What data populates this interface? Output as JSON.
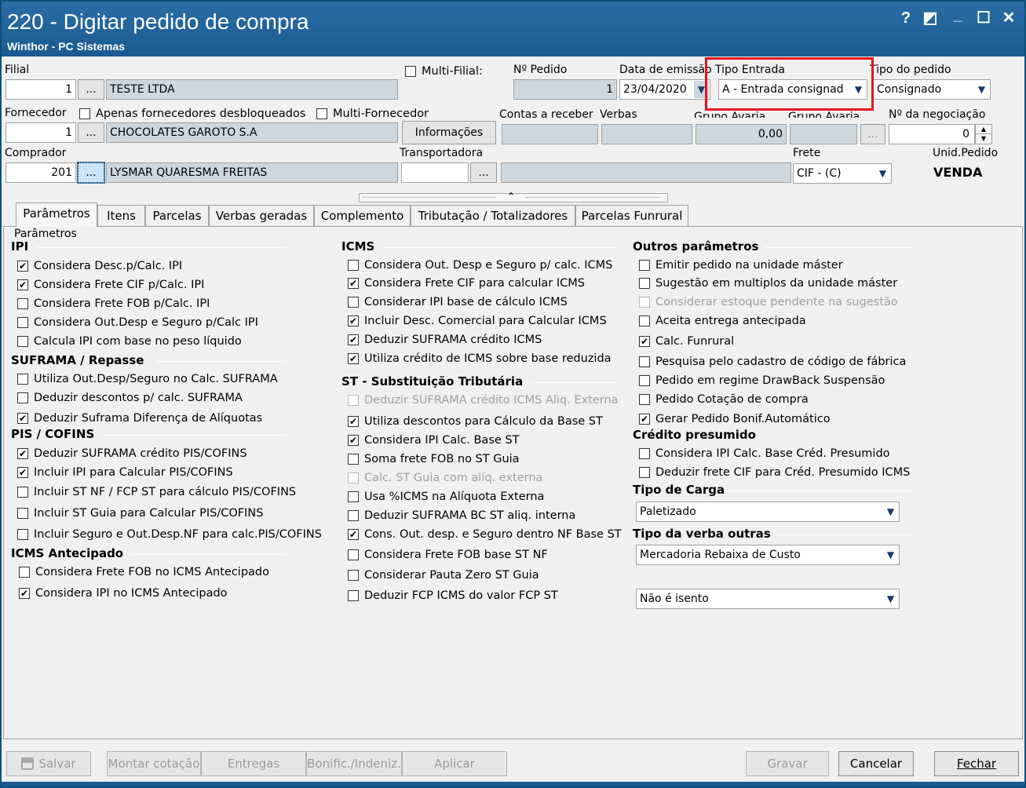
{
  "window": {
    "title": "220 - Digitar pedido de compra",
    "subtitle": "Winthor - PC Sistemas",
    "controls": [
      "?",
      "◩",
      "_",
      "☐",
      "✕"
    ]
  },
  "header": {
    "filial_label": "Filial",
    "filial_code": "1",
    "filial_name": "TESTE  LTDA",
    "multi_filial_label": "Multi-Filial:",
    "num_pedido_label": "Nº Pedido",
    "num_pedido": "1",
    "data_emissao_label": "Data de emissão",
    "data_emissao": "23/04/2020",
    "tipo_entrada_label": "Tipo Entrada",
    "tipo_entrada": "A - Entrada consignad",
    "tipo_pedido_label": "Tipo do pedido",
    "tipo_pedido": "Consignado",
    "fornecedor_label": "Fornecedor",
    "apenas_desbloqueados_label": "Apenas fornecedores desbloqueados",
    "multi_fornecedor_label": "Multi-Fornecedor",
    "fornecedor_code": "1",
    "fornecedor_name": "CHOCOLATES GAROTO S.A",
    "informacoes_label": "Informações",
    "contas_receber_label": "Contas a receber",
    "verbas_label": "Verbas",
    "grupo_avaria_label1": "Grupo Avaria",
    "grupo_avaria_value": "0,00",
    "grupo_avaria_label2": "Grupo Avaria",
    "num_negociacao_label": "Nº da negociação",
    "num_negociacao": "0",
    "comprador_label": "Comprador",
    "comprador_code": "201",
    "comprador_name": "LYSMAR QUARESMA FREITAS",
    "transportadora_label": "Transportadora",
    "frete_label": "Frete",
    "frete": "CIF - (C)",
    "unid_pedido_label": "Unid.Pedido",
    "unid_pedido": "VENDA",
    "ellipsis": "..."
  },
  "highlight_color": "#e8141c",
  "tabs": [
    "Parâmetros",
    "Itens",
    "Parcelas",
    "Verbas geradas",
    "Complemento",
    "Tributação / Totalizadores",
    "Parcelas Funrural"
  ],
  "group_title": "Parâmetros",
  "col1": {
    "ipi_title": "IPI",
    "ipi": [
      {
        "label": "Considera Desc.p/Calc. IPI",
        "checked": true
      },
      {
        "label": "Considera Frete CIF p/Calc. IPI",
        "checked": true
      },
      {
        "label": "Considera Frete FOB p/Calc. IPI",
        "checked": false
      },
      {
        "label": "Considera Out.Desp e Seguro p/Calc IPI",
        "checked": false
      },
      {
        "label": "Calcula IPI com base no peso líquido",
        "checked": false
      }
    ],
    "suframa_title": "SUFRAMA / Repasse",
    "suframa": [
      {
        "label": "Utiliza Out.Desp/Seguro no Calc. SUFRAMA",
        "checked": false
      },
      {
        "label": "Deduzir descontos p/ calc. SUFRAMA",
        "checked": false
      },
      {
        "label": "Deduzir Suframa Diferença de Alíquotas",
        "checked": true
      }
    ],
    "pis_title": "PIS / COFINS",
    "pis": [
      {
        "label": "Deduzir SUFRAMA crédito PIS/COFINS",
        "checked": true
      },
      {
        "label": "Incluir IPI para Calcular PIS/COFINS",
        "checked": true
      },
      {
        "label": "Incluir ST NF / FCP ST para cálculo PIS/COFINS",
        "checked": false
      },
      {
        "label": "Incluir ST Guia para Calcular PIS/COFINS",
        "checked": false
      },
      {
        "label": "Incluir Seguro e Out.Desp.NF para calc.PIS/COFINS",
        "checked": false
      }
    ],
    "icmsant_title": "ICMS Antecipado",
    "icmsant": [
      {
        "label": "Considera Frete FOB no ICMS Antecipado",
        "checked": false
      },
      {
        "label": "Considera IPI no ICMS Antecipado",
        "checked": true
      }
    ]
  },
  "col2": {
    "icms_title": "ICMS",
    "icms": [
      {
        "label": "Considera Out. Desp e Seguro p/ calc. ICMS",
        "checked": false,
        "disabled": false
      },
      {
        "label": "Considera Frete CIF para calcular ICMS",
        "checked": true,
        "disabled": false
      },
      {
        "label": "Considerar IPI base de cálculo ICMS",
        "checked": false,
        "disabled": false
      },
      {
        "label": "Incluir Desc. Comercial  para Calcular ICMS",
        "checked": true,
        "disabled": false
      },
      {
        "label": "Deduzir SUFRAMA crédito ICMS",
        "checked": true,
        "disabled": false
      },
      {
        "label": "Utiliza crédito de ICMS sobre base reduzida",
        "checked": true,
        "disabled": false
      }
    ],
    "st_title": "ST - Substituição Tributária",
    "st": [
      {
        "label": "Deduzir SUFRAMA crédito ICMS Aliq. Externa",
        "checked": false,
        "disabled": true
      },
      {
        "label": "Utiliza descontos para Cálculo da Base ST",
        "checked": true,
        "disabled": false
      },
      {
        "label": "Considera IPI Calc. Base ST",
        "checked": true,
        "disabled": false
      },
      {
        "label": "Soma frete FOB no ST Guia",
        "checked": false,
        "disabled": false
      },
      {
        "label": "Calc. ST Guia com alíq. externa",
        "checked": false,
        "disabled": true
      },
      {
        "label": "Usa %ICMS na Alíquota Externa",
        "checked": false,
        "disabled": false
      },
      {
        "label": "Deduzir SUFRAMA BC ST aliq. interna",
        "checked": false,
        "disabled": false
      },
      {
        "label": "Cons. Out. desp. e Seguro dentro NF Base ST",
        "checked": true,
        "disabled": false
      },
      {
        "label": "Considera Frete FOB base ST NF",
        "checked": false,
        "disabled": false
      },
      {
        "label": "Considerar Pauta Zero ST Guia",
        "checked": false,
        "disabled": false
      },
      {
        "label": "Deduzir FCP ICMS do valor FCP ST",
        "checked": false,
        "disabled": false
      }
    ]
  },
  "col3": {
    "outros_title": "Outros parâmetros",
    "outros": [
      {
        "label": "Emitir pedido na unidade máster",
        "checked": false,
        "disabled": false
      },
      {
        "label": "Sugestão em multiplos da unidade máster",
        "checked": false,
        "disabled": false
      },
      {
        "label": "Considerar estoque pendente na sugestão",
        "checked": false,
        "disabled": true
      },
      {
        "label": "Aceita entrega antecipada",
        "checked": false,
        "disabled": false
      },
      {
        "label": "Calc. Funrural",
        "checked": true,
        "disabled": false
      },
      {
        "label": "Pesquisa pelo cadastro de código de fábrica",
        "checked": false,
        "disabled": false
      },
      {
        "label": "Pedido em regime DrawBack Suspensão",
        "checked": false,
        "disabled": false
      },
      {
        "label": "Pedido Cotação de compra",
        "checked": false,
        "disabled": false
      },
      {
        "label": "Gerar Pedido Bonif.Automático",
        "checked": true,
        "disabled": false
      }
    ],
    "credito_title": "Crédito presumido",
    "credito": [
      {
        "label": "Considera IPI Calc. Base Créd. Presumido",
        "checked": false,
        "disabled": false
      },
      {
        "label": "Deduzir frete CIF para Créd. Presumido ICMS",
        "checked": false,
        "disabled": false
      }
    ],
    "tipo_carga_title": "Tipo de Carga",
    "tipo_carga": "Paletizado",
    "tipo_verba_title": "Tipo da verba outras",
    "tipo_verba": "Mercadoria Rebaixa de Custo",
    "isento": "Não é isento"
  },
  "footer": {
    "salvar": "Salvar",
    "montar_cotacao": "Montar cotação",
    "entregas": "Entregas",
    "bonific": "Bonific./Indeniz.",
    "aplicar": "Aplicar",
    "gravar": "Gravar",
    "cancelar": "Cancelar",
    "fechar": "Fechar"
  }
}
